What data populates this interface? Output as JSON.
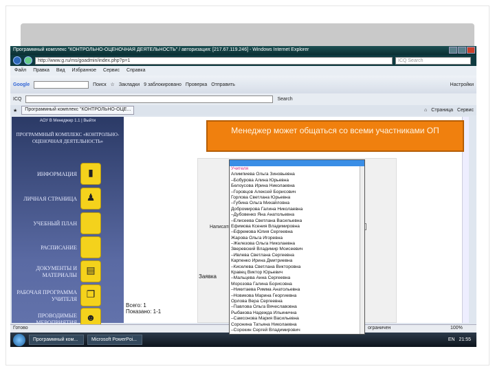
{
  "window": {
    "title": "Программный комплекс \"КОНТРОЛЬНО-ОЦЕНОЧНАЯ ДЕЯТЕЛЬНОСТЬ\" / авторизация: [217.67.119.246] - Windows Internet Explorer",
    "address": "http://www.g.ru/ms/goadmin/index.php?p=1",
    "search_placeholder": "ICQ Search"
  },
  "menu": [
    "Файл",
    "Правка",
    "Вид",
    "Избранное",
    "Сервис",
    "Справка"
  ],
  "google_toolbar": {
    "logo": "Google",
    "search_btn": "Поиск",
    "bookmarks": "Закладки",
    "blocked": "9 заблокировано",
    "check": "Проверка",
    "send": "Отправить",
    "settings": "Настройки"
  },
  "toolbar2": {
    "icq": "ICQ",
    "search": "Search"
  },
  "tab": {
    "label": "Программный комплекс \"КОНТРОЛЬНО-ОЦЕ...",
    "page": "Страница",
    "tools": "Сервис"
  },
  "sidebar": {
    "top": "АОУ В Менеджер 1.1 | Выйти",
    "brand": "ПРОГРАММНЫЙ КОМПЛЕКС «КОНТРОЛЬНО-ОЦЕНОЧНАЯ ДЕЯТЕЛЬНОСТЬ»",
    "items": [
      {
        "label": "ИНФОРМАЦИЯ",
        "icon": "bar-chart-icon"
      },
      {
        "label": "ЛИЧНАЯ СТРАНИЦА",
        "icon": "person-icon"
      },
      {
        "label": "УЧЕБНЫЙ ПЛАН",
        "icon": ""
      },
      {
        "label": "РАСПИСАНИЕ",
        "icon": ""
      },
      {
        "label": "ДОКУМЕНТЫ И МАТЕРИАЛЫ",
        "icon": "document-search-icon"
      },
      {
        "label": "РАБОЧАЯ ПРОГРАММА УЧИТЕЛЯ",
        "icon": "windows-icon"
      },
      {
        "label": "ПРОВОДИМЫЕ МЕРОПРИЯТИЯ",
        "icon": "people-icon"
      }
    ]
  },
  "callout": "Менеджер может общаться со всеми участниками ОП",
  "form": {
    "write_label": "Написать",
    "request_label": "Заявка",
    "total": "Всего: 1",
    "shown": "Показано: 1-1"
  },
  "recipients": [
    "Учителя",
    "Алимпиева Ольга Зиновьевна",
    "–Бобурова Алина Юрьевна",
    "Белоусова Ирина Николаевна",
    "–Горовцов Алексей Борисович",
    "Горлова Светлана Юрьевна",
    "–Губина Ольга Михайловна",
    "Добромирова Галина Николаевна",
    "–Дубовенко Яна Анатольевна",
    "–Елисеева Светлана Васильевна",
    "Ефимова Ксения Владимировна",
    "–Ефремова Юлия Сергеевна",
    "Жарова Ольга Игоревна",
    "–Железова Ольга Николаевна",
    "Зверевский Владимир Моисеевич",
    "–Ивлева Светлана Сергеевна",
    "Карпенко Ирина Дмитриевна",
    "–Киселева Светлана Викторовна",
    "Кравец Виктор Юрьевич",
    "–Мальцева Анна Сергеевна",
    "Морозова Галина Борисовна",
    "–Никитаева Римма Анатольевна",
    "–Новикова Марина Георгиевна",
    "Орлова Вера Сергеевна",
    "–Павлова Ольга Вячеславовна",
    "Рыбакова Надежда Ильинична",
    "–Самсонова Мария Васильевна",
    "Соронина Татьяна Николаевна",
    "–Сорокин Сергей Владимирович"
  ],
  "status": {
    "left": "Готово",
    "zone": "ограничен",
    "zoom": "100%"
  },
  "taskbar": {
    "items": [
      "Программный ком...",
      "Microsoft PowerPoi..."
    ],
    "lang": "EN",
    "clock": "21:55"
  }
}
